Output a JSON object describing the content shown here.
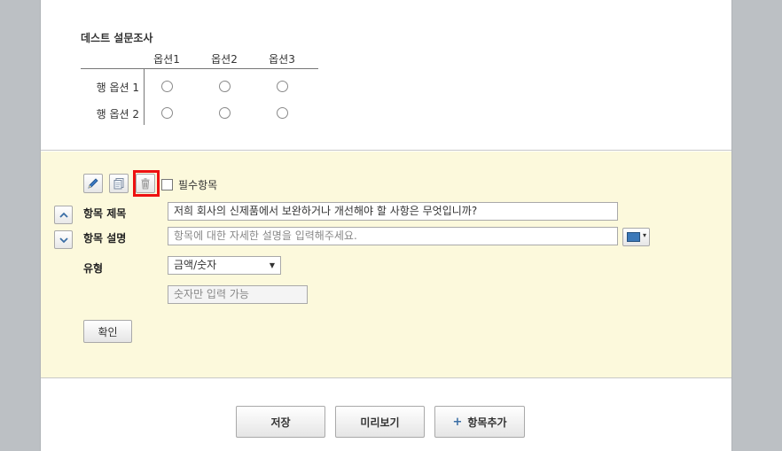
{
  "survey": {
    "title": "데스트 설문조사",
    "columns": [
      "옵션1",
      "옵션2",
      "옵션3"
    ],
    "rows": [
      "행 옵션 1",
      "행 옵션 2"
    ]
  },
  "toolbar": {
    "edit_icon": "pencil-icon",
    "copy_icon": "copy-icon",
    "delete_icon": "trash-icon",
    "required_label": "필수항목",
    "required_checked": false
  },
  "form": {
    "title_label": "항목 제목",
    "title_value": "저희 회사의 신제품에서 보완하거나 개선해야 할 사항은 무엇입니까?",
    "desc_label": "항목 설명",
    "desc_placeholder": "항목에 대한 자세한 설명을 입력해주세요.",
    "type_label": "유형",
    "type_value": "금액/숫자",
    "number_placeholder": "숫자만 입력 가능",
    "confirm_label": "확인",
    "text_color": "#3b78b8"
  },
  "footer": {
    "save_label": "저장",
    "preview_label": "미리보기",
    "add_label": "항목추가"
  },
  "colors": {
    "editor_bg": "#fcf9dc",
    "highlight": "#e11111",
    "accent": "#3a6ea5"
  }
}
